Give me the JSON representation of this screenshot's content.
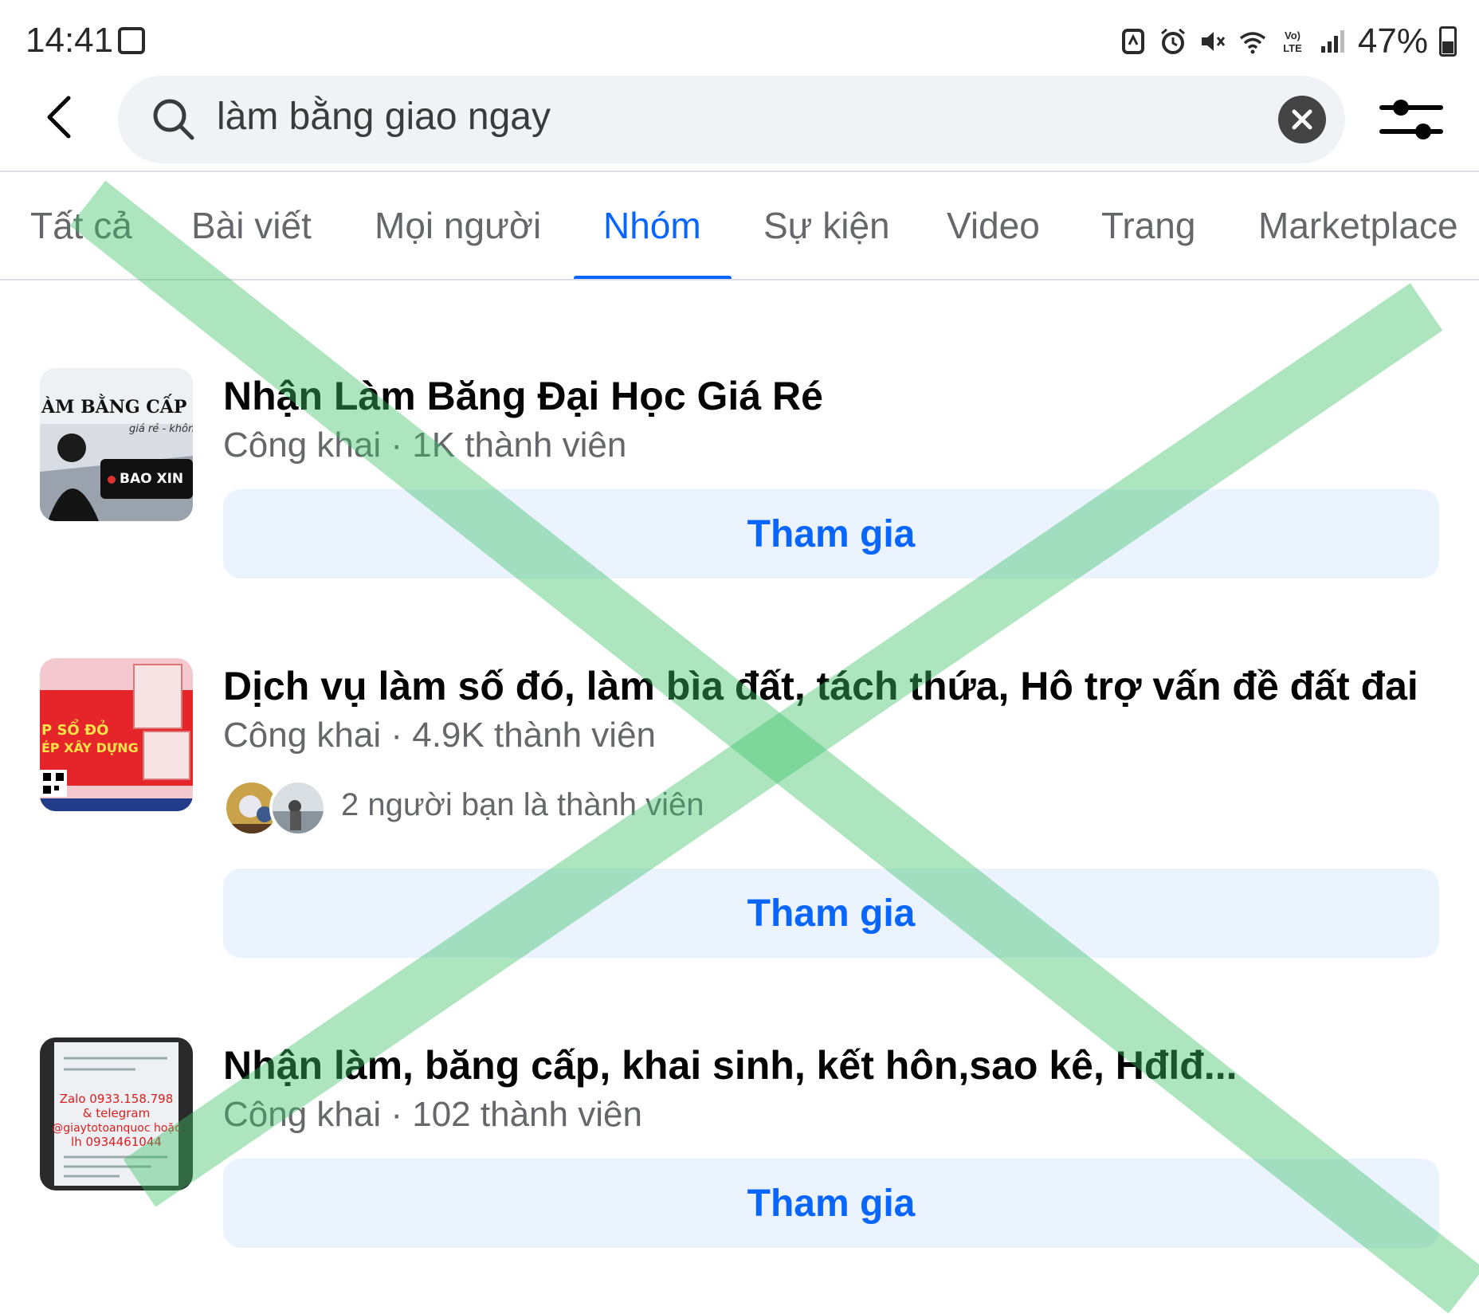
{
  "status_bar": {
    "time": "14:41",
    "battery": "47%",
    "icons": [
      "image-icon",
      "nfc-icon",
      "alarm-icon",
      "mute-icon",
      "wifi-icon",
      "volte-icon",
      "signal-icon",
      "battery-icon"
    ]
  },
  "search": {
    "query": "làm bằng giao ngay"
  },
  "tabs": [
    {
      "label": "Tất cả"
    },
    {
      "label": "Bài viết"
    },
    {
      "label": "Mọi người"
    },
    {
      "label": "Nhóm",
      "active": true
    },
    {
      "label": "Sự kiện"
    },
    {
      "label": "Video"
    },
    {
      "label": "Trang"
    },
    {
      "label": "Marketplace"
    }
  ],
  "results": [
    {
      "title": "Nhận Làm Băng Đại Học Giá Ré",
      "meta": "Công khai · 1K thành viên",
      "join_label": "Tham gia",
      "thumb_text": {
        "line1": "ÀM BẰNG CẤP U",
        "line2": "giá rẻ - khôn",
        "line3": "BAO XIN"
      }
    },
    {
      "title": "Dịch vụ làm số đó, làm bìa đất, tách thứa, Hô  trợ vấn đề đất đai",
      "meta": "Công khai · 4.9K thành viên",
      "friends": "2 người bạn là thành viên",
      "join_label": "Tham gia",
      "thumb_text": {
        "line1": "P SỔ ĐỎ",
        "line2": "ÉP XÂY DỰNG"
      }
    },
    {
      "title": "Nhận làm, băng cấp, khai sinh, kết hôn,sao kê, Hđlđ...",
      "meta": "Công khai · 102 thành viên",
      "join_label": "Tham gia",
      "thumb_text": {
        "line1": "Zalo 0933.158.798",
        "line2": "& telegram",
        "line3": "@giaytotoanquoc hoặc",
        "line4": "lh 0934461044"
      }
    }
  ],
  "colors": {
    "accent": "#0866ff",
    "join_bg": "#ebf3ff",
    "watermark": "#3cc266"
  }
}
